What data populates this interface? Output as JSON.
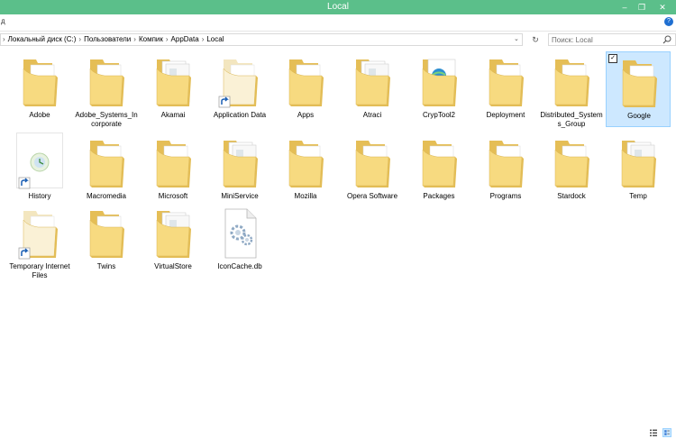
{
  "window": {
    "title": "Local",
    "minimize": "–",
    "maximize": "❐",
    "close": "✕"
  },
  "ribbon": {
    "collapsed": "д",
    "help": "?"
  },
  "address": {
    "path": [
      "Локальный диск (C:)",
      "Пользователи",
      "Компик",
      "AppData",
      "Local"
    ],
    "separator": "›",
    "dropdown": "⌄",
    "refresh": "↻"
  },
  "search": {
    "placeholder": "Поиск: Local"
  },
  "items": [
    {
      "label": "Adobe",
      "kind": "folder"
    },
    {
      "label": "Adobe_Systems_Incorporate",
      "kind": "folder"
    },
    {
      "label": "Akamai",
      "kind": "folder-docs"
    },
    {
      "label": "Application Data",
      "kind": "folder-shortcut"
    },
    {
      "label": "Apps",
      "kind": "folder"
    },
    {
      "label": "Atraci",
      "kind": "folder-docs"
    },
    {
      "label": "CrypTool2",
      "kind": "folder-globe"
    },
    {
      "label": "Deployment",
      "kind": "folder"
    },
    {
      "label": "Distributed_Systems_Group",
      "kind": "folder"
    },
    {
      "label": "Google",
      "kind": "folder",
      "selected": true
    },
    {
      "label": "History",
      "kind": "thumb-shortcut"
    },
    {
      "label": "Macromedia",
      "kind": "folder"
    },
    {
      "label": "Microsoft",
      "kind": "folder"
    },
    {
      "label": "MiniService",
      "kind": "folder-docs"
    },
    {
      "label": "Mozilla",
      "kind": "folder"
    },
    {
      "label": "Opera Software",
      "kind": "folder"
    },
    {
      "label": "Packages",
      "kind": "folder"
    },
    {
      "label": "Programs",
      "kind": "folder"
    },
    {
      "label": "Stardock",
      "kind": "folder"
    },
    {
      "label": "Temp",
      "kind": "folder-docs"
    },
    {
      "label": "Temporary Internet Files",
      "kind": "folder-shortcut"
    },
    {
      "label": "Twins",
      "kind": "folder"
    },
    {
      "label": "VirtualStore",
      "kind": "folder-docs"
    },
    {
      "label": "IconCache.db",
      "kind": "file-db"
    }
  ],
  "colors": {
    "titlebar": "#5bbf8a",
    "selection": "#cde8ff",
    "folder": "#f6d77c",
    "folderBack": "#e8c25e"
  }
}
